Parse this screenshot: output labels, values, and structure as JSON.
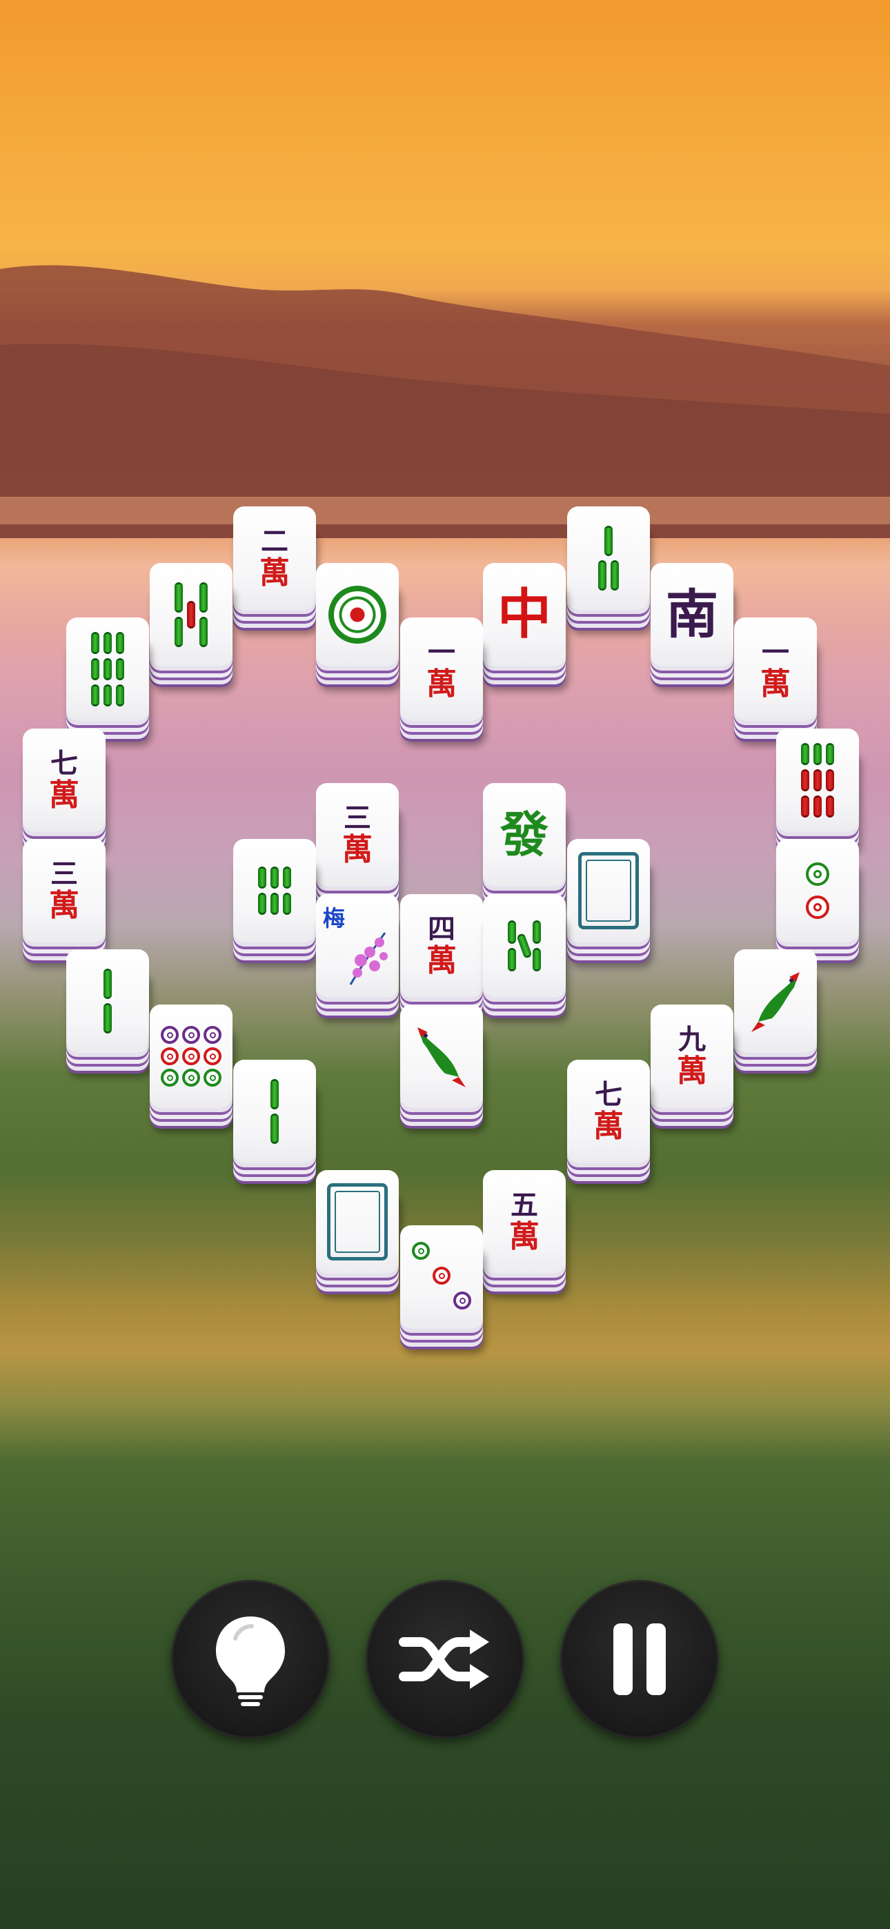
{
  "game": {
    "title": ""
  },
  "tiles": {
    "t01": {
      "num": "二",
      "suit": "萬"
    },
    "t02": {
      "kind": "bamboo-2"
    },
    "t03": {
      "kind": "bamboo-9"
    },
    "t04": {
      "kind": "dot-1"
    },
    "t05": {
      "num": "一",
      "suit": "萬"
    },
    "t06": {
      "big": "中"
    },
    "t07": {
      "kind": "bamboo-3"
    },
    "t08": {
      "big": "南"
    },
    "t09": {
      "num": "一",
      "suit": "萬"
    },
    "t10": {
      "kind": "bamboo-9-red"
    },
    "t11": {
      "num": "七",
      "suit": "萬"
    },
    "t12": {
      "num": "三",
      "suit": "萬"
    },
    "t13": {
      "kind": "dot-2"
    },
    "t14": {
      "kind": "bamboo-2-plain"
    },
    "t15": {
      "kind": "dot-9"
    },
    "t16": {
      "kind": "bamboo-2-plain"
    },
    "t17": {
      "kind": "white-dragon"
    },
    "t18": {
      "kind": "dot-3"
    },
    "t19": {
      "num": "五",
      "suit": "萬"
    },
    "t20": {
      "num": "七",
      "suit": "萬"
    },
    "t21": {
      "num": "九",
      "suit": "萬"
    },
    "t22": {
      "kind": "bird"
    },
    "t23": {
      "kind": "bamboo-6"
    },
    "t24": {
      "num": "三",
      "suit": "萬"
    },
    "t25": {
      "big": "發"
    },
    "t26": {
      "kind": "white-dragon"
    },
    "t27": {
      "flower": "梅"
    },
    "t28": {
      "num": "四",
      "suit": "萬"
    },
    "t29": {
      "kind": "bamboo-5"
    },
    "t30": {
      "kind": "bird"
    }
  },
  "controls": {
    "hint": {
      "icon": "lightbulb-icon"
    },
    "shuffle": {
      "icon": "shuffle-icon"
    },
    "pause": {
      "icon": "pause-icon"
    }
  },
  "colors": {
    "wan_red": "#d11a1a",
    "num_purple": "#3b1a4e",
    "bamboo_green": "#1e8a1e",
    "tile_side_purple": "#8a5aa8",
    "button_dark": "#1a1a1a"
  }
}
